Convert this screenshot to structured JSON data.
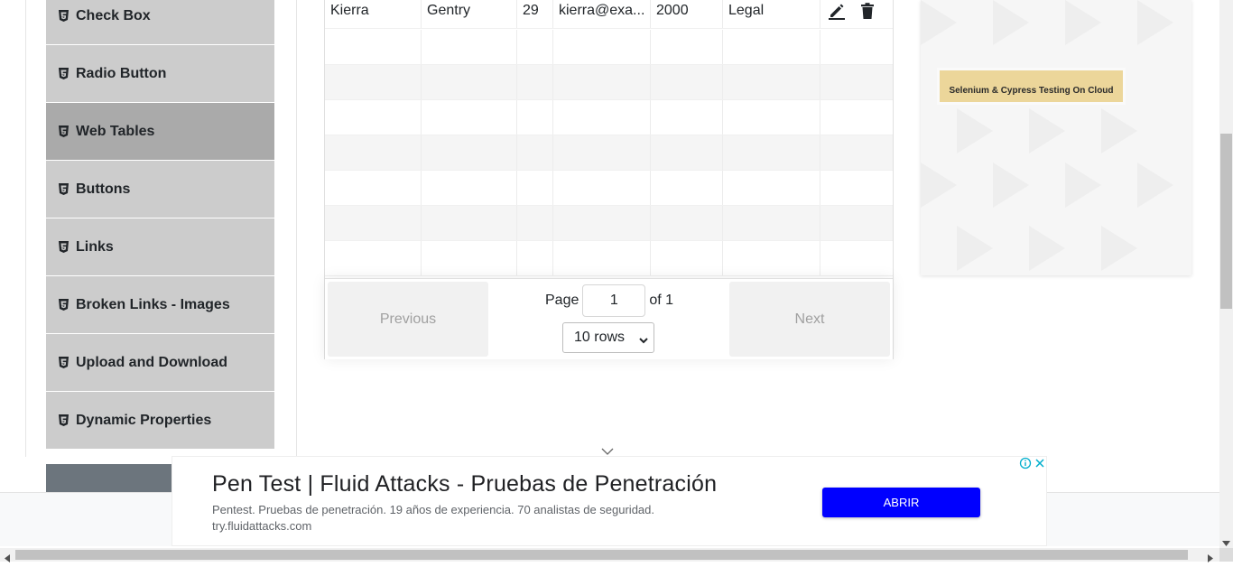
{
  "sidebar": {
    "items": [
      {
        "label": "Check Box",
        "icon": "html5-icon",
        "active": false
      },
      {
        "label": "Radio Button",
        "icon": "html5-icon",
        "active": false
      },
      {
        "label": "Web Tables",
        "icon": "html5-icon",
        "active": true
      },
      {
        "label": "Buttons",
        "icon": "html5-icon",
        "active": false
      },
      {
        "label": "Links",
        "icon": "html5-icon",
        "active": false
      },
      {
        "label": "Broken Links - Images",
        "icon": "html5-icon",
        "active": false
      },
      {
        "label": "Upload and Download",
        "icon": "html5-icon",
        "active": false
      },
      {
        "label": "Dynamic Properties",
        "icon": "html5-icon",
        "active": false
      }
    ]
  },
  "table": {
    "rows": [
      {
        "first_name": "Kierra",
        "last_name": "Gentry",
        "age": "29",
        "email": "kierra@exa...",
        "salary": "2000",
        "department": "Legal",
        "actions": [
          "edit-icon",
          "delete-icon"
        ]
      }
    ],
    "empty_row_count": 7
  },
  "pagination": {
    "previous_label": "Previous",
    "next_label": "Next",
    "page_label": "Page",
    "page_value": "1",
    "of_label": "of 1",
    "rows_select": "10 rows"
  },
  "ad_right": {
    "banner_text": "Selenium & Cypress Testing On Cloud"
  },
  "ad_bottom": {
    "title": "Pen Test | Fluid Attacks - Pruebas de Penetración",
    "description": "Pentest. Pruebas de penetración. 19 años de experiencia. 70 analistas de seguridad.",
    "url": "try.fluidattacks.com",
    "cta_label": "ABRIR"
  },
  "colors": {
    "menu_bg": "#cccccc",
    "menu_active_bg": "#aaaaaa",
    "cta_bg": "#0000ff",
    "ad_banner_bg": "#ecd69a"
  }
}
